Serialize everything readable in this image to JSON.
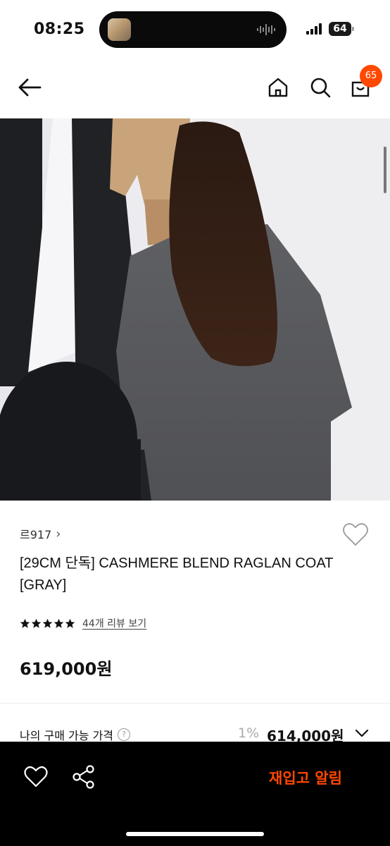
{
  "status_bar": {
    "time": "08:25",
    "battery": "64"
  },
  "nav": {
    "back_icon": "arrow-left-icon",
    "home_icon": "home-icon",
    "search_icon": "search-icon",
    "cart_icon": "shopping-bag-icon",
    "cart_count": "65",
    "badge_color": "#ff4800"
  },
  "product": {
    "brand": "르917",
    "brand_chevron": "›",
    "title": "[29CM 단독] CASHMERE BLEND RAGLAN COAT [GRAY]",
    "rating": 5,
    "review_link": "44개 리뷰 보기",
    "price": "619,000원"
  },
  "buy_row": {
    "label": "나의 구매 가능 가격",
    "help": "?",
    "discount": "1%",
    "price": "614,000원",
    "expand_icon": "chevron-down-icon"
  },
  "bottom_bar": {
    "wish_icon": "heart-icon",
    "share_icon": "share-icon",
    "restock_label": "재입고 알림",
    "accent": "#ff4800"
  }
}
